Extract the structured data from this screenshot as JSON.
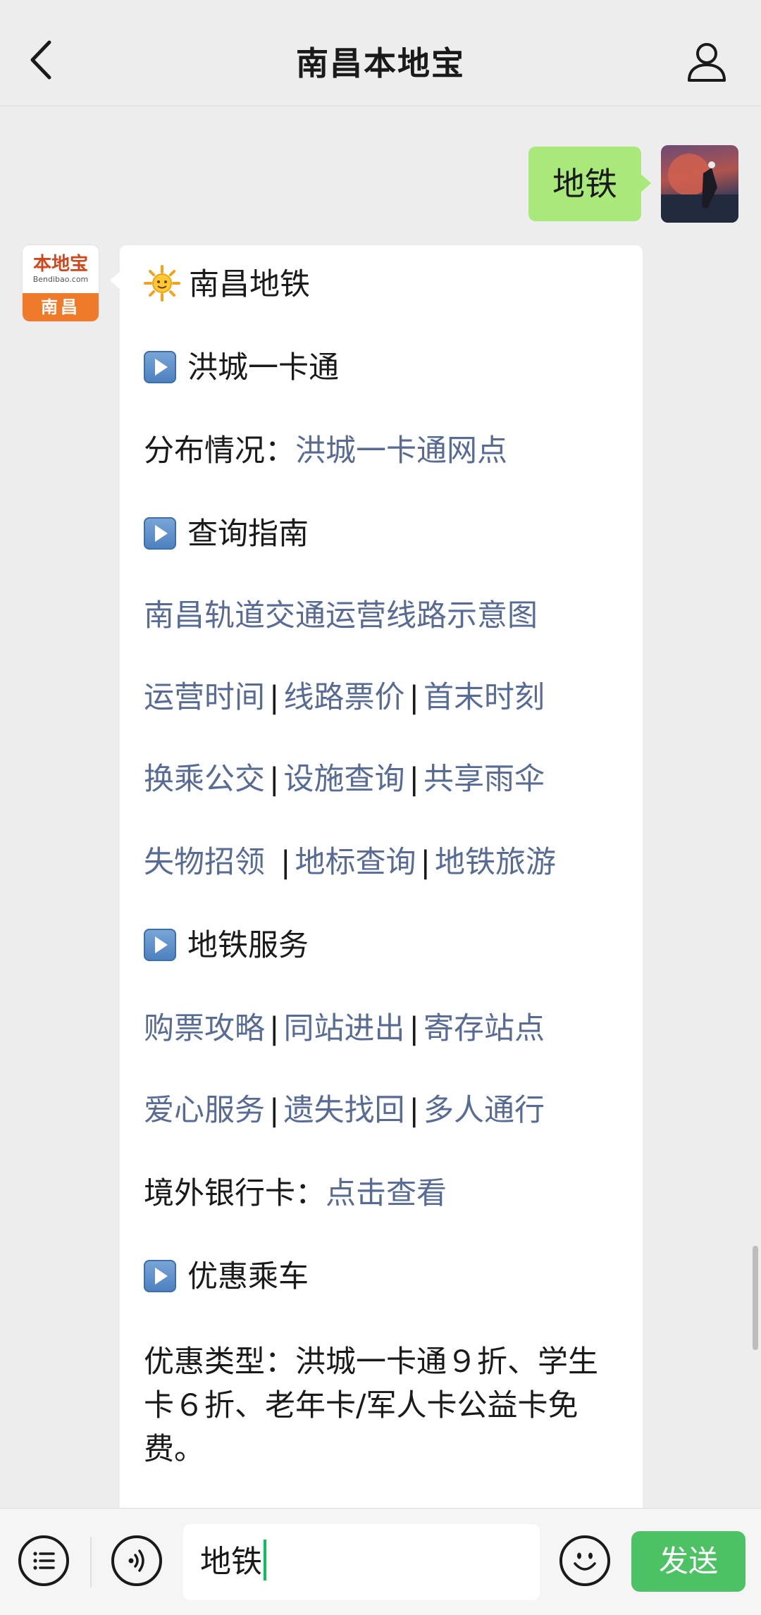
{
  "header": {
    "title": "南昌本地宝",
    "back_icon": "chevron-left-icon",
    "profile_icon": "person-icon"
  },
  "user_message": {
    "text": "地铁"
  },
  "bot_avatar": {
    "logo_text": "本地宝",
    "url_text": "Bendibao.com",
    "city": "南昌"
  },
  "bot_message": {
    "title": "南昌地铁",
    "sections": {
      "card": {
        "heading": "洪城一卡通",
        "dist_label": "分布情况：",
        "dist_link": "洪城一卡通网点"
      },
      "query": {
        "heading": "查询指南",
        "map_link": "南昌轨道交通运营线路示意图",
        "row1": [
          "运营时间",
          "线路票价",
          "首末时刻"
        ],
        "row2": [
          "换乘公交",
          "设施查询",
          "共享雨伞"
        ],
        "row3": [
          "失物招领",
          "地标查询",
          "地铁旅游"
        ]
      },
      "service": {
        "heading": "地铁服务",
        "row1": [
          "购票攻略",
          "同站进出",
          "寄存站点"
        ],
        "row2": [
          "爱心服务",
          "遗失找回",
          "多人通行"
        ],
        "bank_label": "境外银行卡：",
        "bank_link": "点击查看"
      },
      "discount": {
        "heading": "优惠乘车",
        "text": "优惠类型：洪城一卡通９折、学生卡６折、老年卡/军人卡公益卡免费。"
      }
    }
  },
  "separator": "|",
  "input": {
    "value": "地铁"
  },
  "send_button": {
    "label": "发送"
  },
  "colors": {
    "link": "#576b95",
    "user_bubble": "#a9e87a",
    "send": "#4cc265",
    "background": "#ededed"
  }
}
